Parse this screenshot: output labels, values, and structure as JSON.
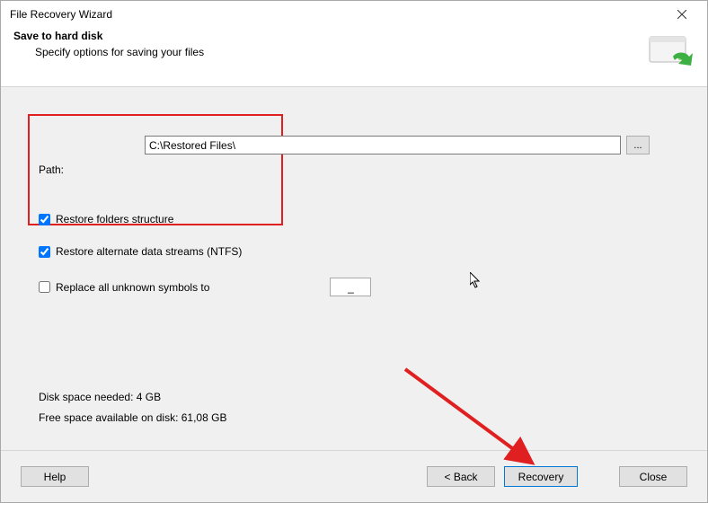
{
  "titlebar": {
    "title": "File Recovery Wizard"
  },
  "header": {
    "heading": "Save to hard disk",
    "subheading": "Specify options for saving your files"
  },
  "form": {
    "path_label": "Path:",
    "path_value": "C:\\Restored Files\\",
    "browse_label": "..."
  },
  "options": {
    "restore_folders": {
      "label": "Restore folders structure",
      "checked": true
    },
    "restore_alt_streams": {
      "label": "Restore alternate data streams (NTFS)",
      "checked": true
    },
    "replace_symbols": {
      "label": "Replace all unknown symbols to",
      "checked": false,
      "value": "_"
    }
  },
  "disk": {
    "needed": "Disk space needed: 4 GB",
    "free": "Free space available on disk: 61,08 GB"
  },
  "buttons": {
    "help": "Help",
    "back": "< Back",
    "recovery": "Recovery",
    "close": "Close"
  }
}
